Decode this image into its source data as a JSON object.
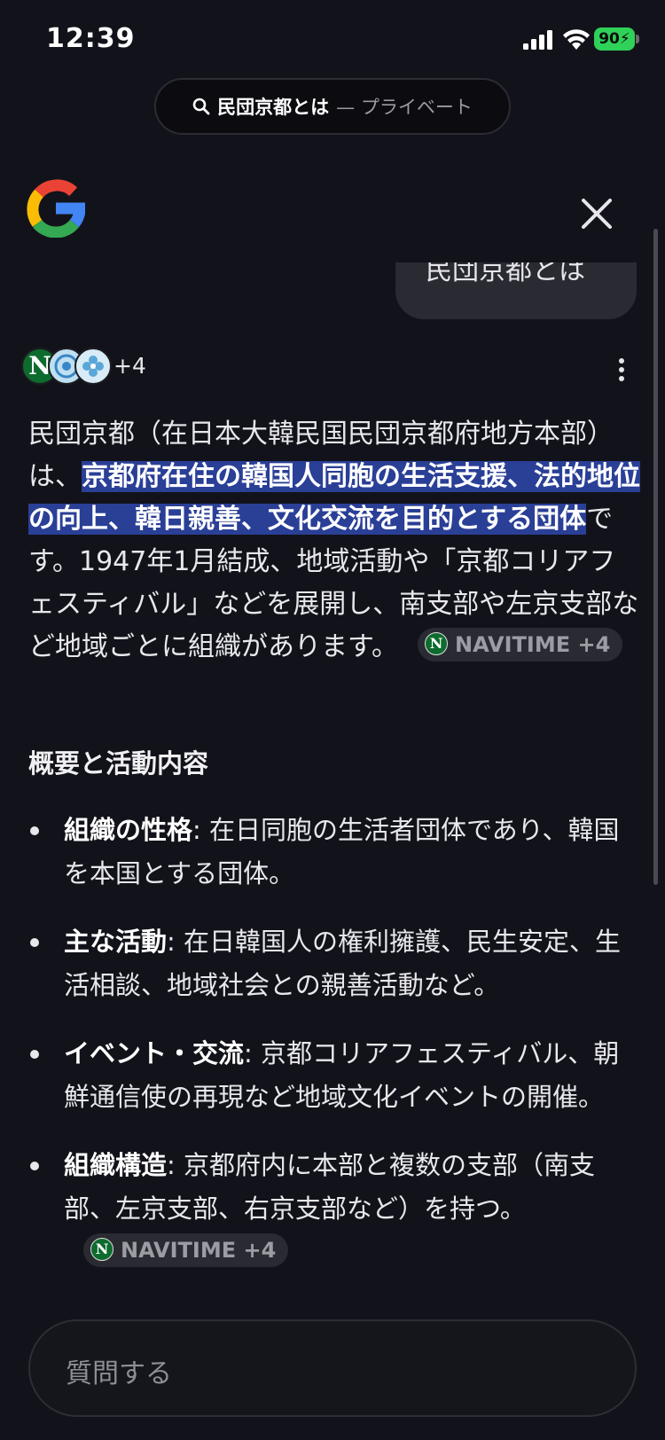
{
  "status": {
    "time": "12:39",
    "battery": "90"
  },
  "search_pill": {
    "query": "民団京都とは",
    "mode": "— プライベート"
  },
  "user_message": "民団京都とは",
  "sources": {
    "count": "+4"
  },
  "answer": {
    "part1": "民団京都（在日本大韓民国民団京都府地方本部）は、",
    "highlight": "京都府在住の韓国人同胞の生活支援、法的地位の向上、韓日親善、文化交流を目的とする団体",
    "part2": "です。1947年1月結成、地域活動や「京都コリアフェスティバル」などを展開し、南支部や左京支部など地域ごとに組織があります。",
    "chip_label": "NAVITIME +4"
  },
  "section_title": "概要と活動内容",
  "bullets": [
    {
      "label": "組織の性格",
      "text": ": 在日同胞の生活者団体であり、韓国を本国とする団体。"
    },
    {
      "label": "主な活動",
      "text": ": 在日韓国人の権利擁護、民生安定、生活相談、地域社会との親善活動など。"
    },
    {
      "label": "イベント・交流",
      "text": ": 京都コリアフェスティバル、朝鮮通信使の再現など地域文化イベントの開催。"
    },
    {
      "label": "組織構造",
      "text": ": 京都府内に本部と複数の支部（南支部、左京支部、右京支部など）を持つ。",
      "chip_label": "NAVITIME +4"
    }
  ],
  "input": {
    "placeholder": "質問する"
  },
  "colors": {
    "background": "#12131a",
    "highlight": "#2a3f96",
    "battery": "#2fd158"
  }
}
